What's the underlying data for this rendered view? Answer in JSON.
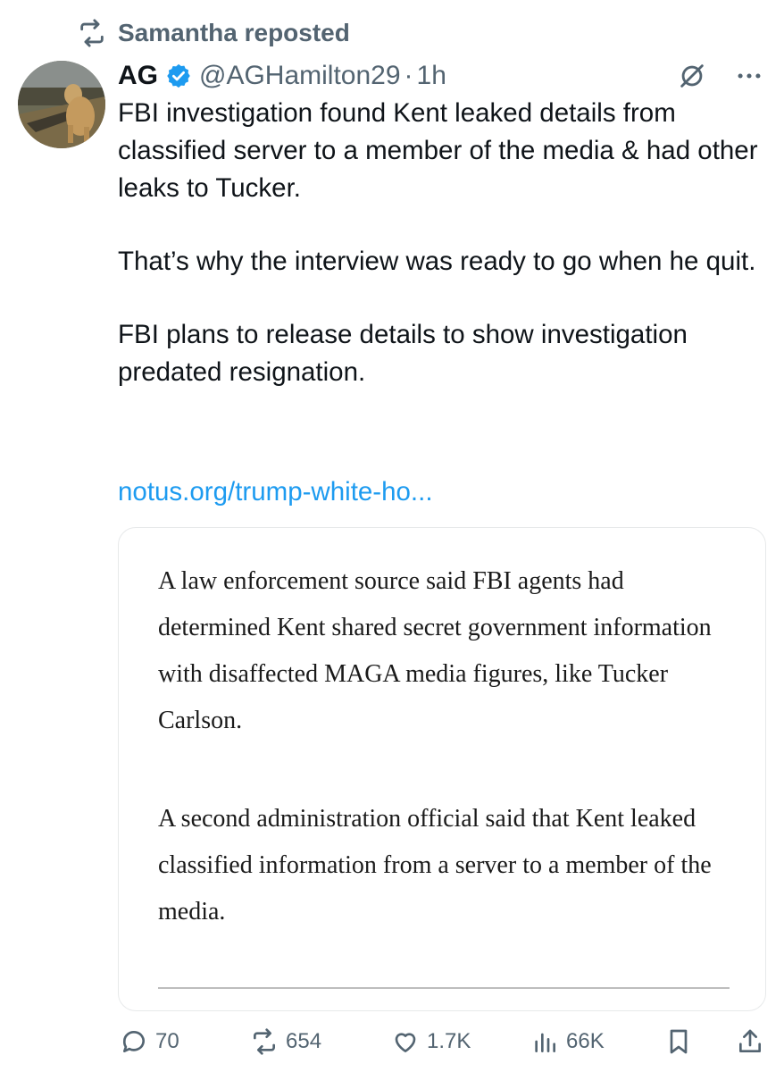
{
  "repost": {
    "label": "Samantha reposted",
    "icon": "repost-icon"
  },
  "author": {
    "name": "AG",
    "verified": true,
    "handle": "@AGHamilton29",
    "separator": "·",
    "time": "1h"
  },
  "tweet": {
    "paragraphs": [
      "FBI investigation found Kent leaked details from classified server to a member of the media & had other leaks to Tucker.",
      "That’s why the interview was ready to go when he quit.",
      "FBI plans to release details to show investigation predated resignation."
    ],
    "link": "notus.org/trump-white-ho..."
  },
  "quote_card": {
    "paragraphs": [
      "A law enforcement source said FBI agents had determined Kent shared secret government information with disaffected MAGA media figures, like Tucker Carlson.",
      "A second administration official said that Kent leaked classified information from a server to a member of the media."
    ]
  },
  "actions": {
    "replies": "70",
    "reposts": "654",
    "likes": "1.7K",
    "views": "66K"
  },
  "colors": {
    "text": "#0f1419",
    "secondary": "#536471",
    "link": "#1d9bf0",
    "verified": "#1d9bf0",
    "border": "#e7e9ea"
  }
}
